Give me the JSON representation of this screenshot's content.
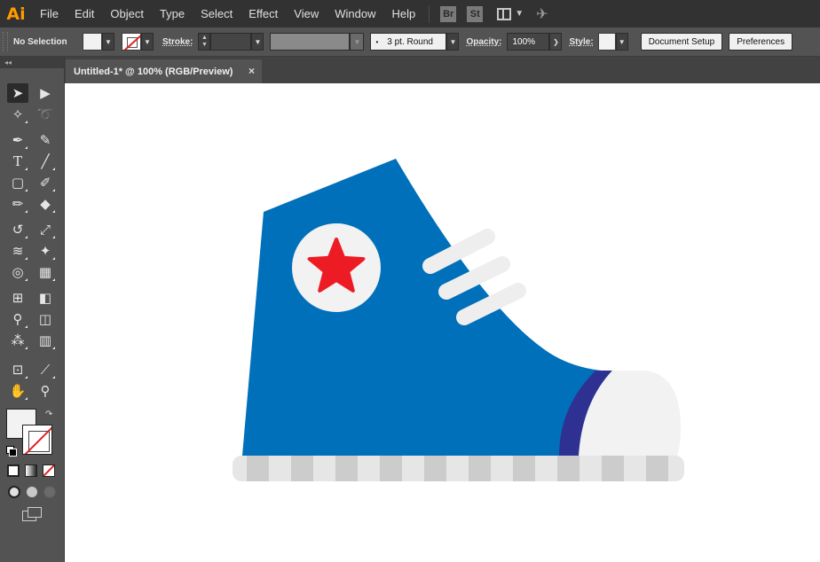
{
  "menubar": {
    "app_logo": "Ai",
    "items": [
      "File",
      "Edit",
      "Object",
      "Type",
      "Select",
      "Effect",
      "View",
      "Window",
      "Help"
    ],
    "bridge": "Br",
    "stock": "St"
  },
  "controlbar": {
    "selection": "No Selection",
    "stroke_label": "Stroke:",
    "brush": "3 pt. Round",
    "opacity_label": "Opacity:",
    "opacity_value": "100%",
    "style_label": "Style:",
    "document_setup": "Document Setup",
    "preferences": "Preferences"
  },
  "document": {
    "tab_title": "Untitled-1* @ 100% (RGB/Preview)",
    "close_symbol": "×"
  },
  "artwork": {
    "colors": {
      "shoe_blue": "#0070BA",
      "band_navy": "#2E3192",
      "star_red": "#ED1C24",
      "badge_white": "#F2F2F2",
      "toe_cap": "#F2F2F2",
      "lace": "#EEEEEE",
      "sole_light": "#E6E6E6",
      "sole_dark": "#CCCCCC"
    }
  },
  "tools": {
    "collapse": "◂◂"
  }
}
